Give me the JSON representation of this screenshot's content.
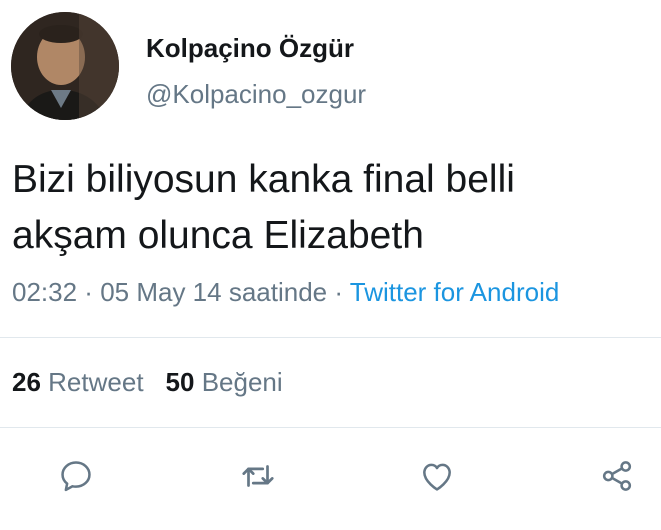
{
  "user": {
    "display_name": "Kolpaçino Özgür",
    "handle": "@Kolpacino_ozgur",
    "avatar": "profile-photo"
  },
  "tweet": {
    "text_line1": "Bizi biliyosun kanka final belli",
    "text_line2": "akşam olunca Elizabeth",
    "time": "02:32",
    "sep1": " · ",
    "date": "05 May 14 saatinde",
    "sep2": " · ",
    "source": "Twitter for Android"
  },
  "stats": {
    "retweets_count": "26",
    "retweets_label": "Retweet",
    "likes_count": "50",
    "likes_label": "Beğeni"
  },
  "actions": {
    "icons": [
      "reply-icon",
      "retweet-icon",
      "like-icon",
      "share-icon"
    ]
  },
  "colors": {
    "text": "#14171a",
    "secondary": "#657786",
    "link": "#1b95e0",
    "divider": "#e1e8ed"
  }
}
